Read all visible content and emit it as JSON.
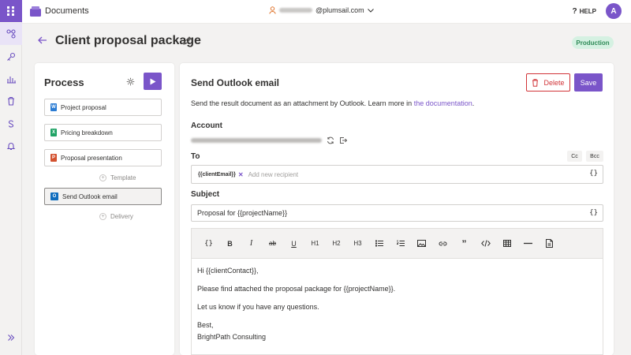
{
  "app": {
    "name": "Documents"
  },
  "header": {
    "user_email_suffix": "@plumsail.com",
    "help_label": "HELP",
    "avatar_letter": "A"
  },
  "page": {
    "title": "Client proposal package",
    "status": "Production"
  },
  "process": {
    "title": "Process",
    "steps": [
      {
        "label": "Project proposal",
        "icon": "word-doc-icon",
        "color": "#2b7cd3"
      },
      {
        "label": "Pricing breakdown",
        "icon": "excel-doc-icon",
        "color": "#21a366"
      },
      {
        "label": "Proposal presentation",
        "icon": "powerpoint-doc-icon",
        "color": "#d35230"
      }
    ],
    "add_template_label": "Template",
    "active_step": {
      "label": "Send Outlook email",
      "icon": "outlook-icon",
      "color": "#0f6cbd"
    },
    "add_delivery_label": "Delivery"
  },
  "email": {
    "title": "Send Outlook email",
    "delete_label": "Delete",
    "save_label": "Save",
    "description": "Send the result document as an attachment by Outlook. Learn more in",
    "description_link": "the documentation",
    "description_end": ".",
    "account_label": "Account",
    "to_label": "To",
    "cc_label": "Cc",
    "bcc_label": "Bcc",
    "to_chip": "{{clientEmail}}",
    "to_placeholder": "Add new recipient",
    "brace_label": "{}",
    "subject_label": "Subject",
    "subject_value": "Proposal for {{projectName}}",
    "toolbar": [
      "{}",
      "B",
      "I",
      "ab",
      "U",
      "H1",
      "H2",
      "H3",
      "bulleted-list-icon",
      "numbered-list-icon",
      "image-icon",
      "link-icon",
      "quote-icon",
      "code-icon",
      "table-icon",
      "horizontal-rule-icon",
      "file-icon"
    ],
    "body": {
      "greeting": "Hi {{clientContact}},",
      "line1": "Please find attached the proposal package for {{projectName}}.",
      "line2": "Let us know if you have any questions.",
      "signoff": "Best,",
      "signature": "BrightPath Consulting"
    }
  },
  "colors": {
    "accent": "#7a55c9",
    "danger": "#d13438",
    "status_bg": "#d5f1e2",
    "status_text": "#2f8a57"
  }
}
